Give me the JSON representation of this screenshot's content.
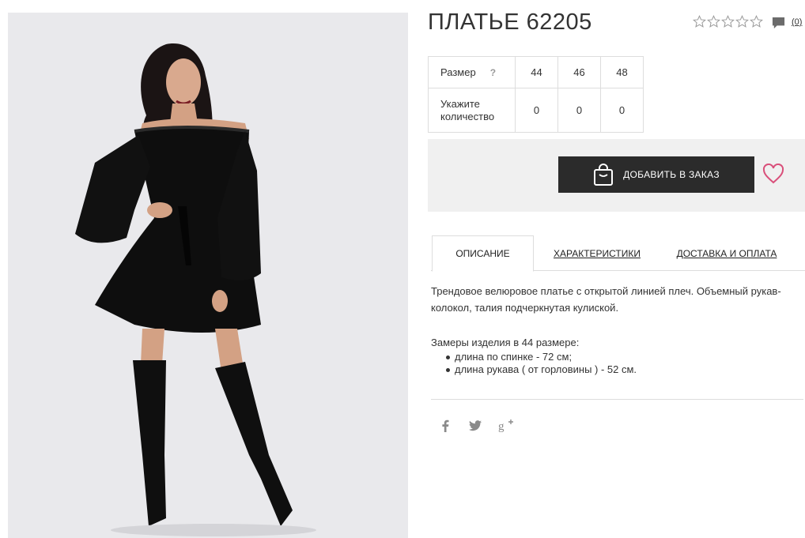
{
  "product": {
    "title": "ПЛАТЬЕ 62205",
    "rating_stars": 0,
    "rating_max": 5,
    "reviews_count": "(0)"
  },
  "sizes": {
    "size_label": "Размер",
    "help_mark": "?",
    "quantity_label": "Укажите количество",
    "options": [
      {
        "size": "44",
        "quantity": "0"
      },
      {
        "size": "46",
        "quantity": "0"
      },
      {
        "size": "48",
        "quantity": "0"
      }
    ]
  },
  "cart": {
    "add_label": "ДОБАВИТЬ В ЗАКАЗ"
  },
  "tabs": [
    {
      "label": "ОПИСАНИЕ",
      "active": true
    },
    {
      "label": "ХАРАКТЕРИСТИКИ",
      "active": false
    },
    {
      "label": "ДОСТАВКА И ОПЛАТА",
      "active": false
    }
  ],
  "description": {
    "text": "Трендовое велюровое платье с открытой линией плеч. Объемный рукав-колокол, талия подчеркнутая кулиской.",
    "measurements_title": "Замеры изделия в 44 размере:",
    "measurements": [
      "длина по спинке - 72 см;",
      "длина рукава ( от горловины ) - 52 см."
    ]
  },
  "social": [
    "facebook-icon",
    "twitter-icon",
    "google-plus-icon"
  ],
  "colors": {
    "button_bg": "#2b2b2b",
    "panel_bg": "#f0f0f0",
    "heart": "#d94f7a",
    "photo_bg": "#e9e9ec"
  }
}
